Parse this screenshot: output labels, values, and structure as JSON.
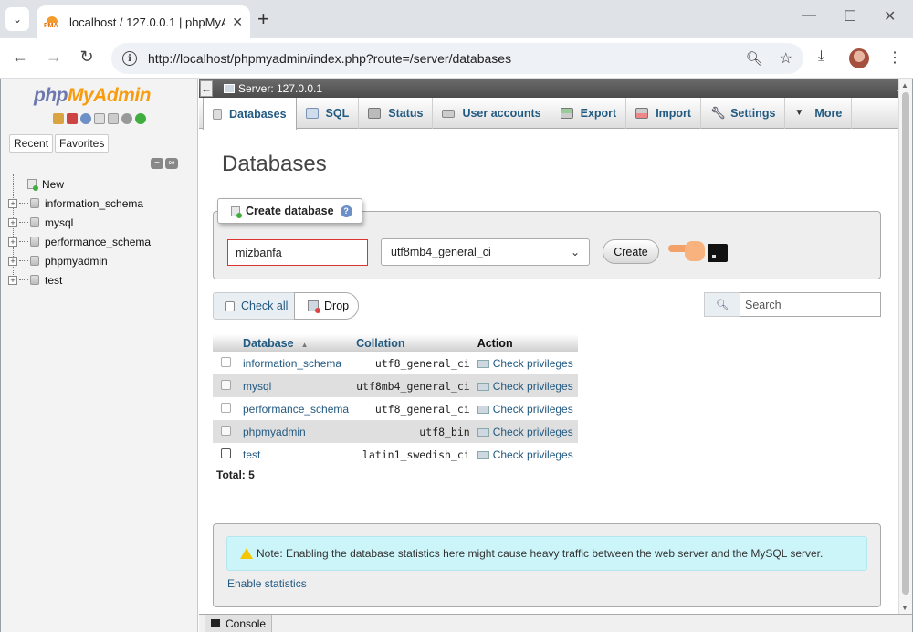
{
  "browser": {
    "tab_title": "localhost / 127.0.0.1 | phpMyAdmin",
    "url": "http://localhost/phpmyadmin/index.php?route=/server/databases"
  },
  "sidebar": {
    "logo_php": "php",
    "logo_myadmin": "MyAdmin",
    "recent_label": "Recent",
    "favorites_label": "Favorites",
    "tree": [
      {
        "label": "New",
        "type": "new"
      },
      {
        "label": "information_schema",
        "type": "db"
      },
      {
        "label": "mysql",
        "type": "db"
      },
      {
        "label": "performance_schema",
        "type": "db"
      },
      {
        "label": "phpmyadmin",
        "type": "db"
      },
      {
        "label": "test",
        "type": "db"
      }
    ]
  },
  "server": {
    "label": "Server: 127.0.0.1"
  },
  "tabs": [
    {
      "label": "Databases",
      "icon": "database-icon",
      "active": true
    },
    {
      "label": "SQL",
      "icon": "sql-icon"
    },
    {
      "label": "Status",
      "icon": "status-icon"
    },
    {
      "label": "User accounts",
      "icon": "users-icon"
    },
    {
      "label": "Export",
      "icon": "export-icon"
    },
    {
      "label": "Import",
      "icon": "import-icon"
    },
    {
      "label": "Settings",
      "icon": "wrench-icon"
    },
    {
      "label": "More",
      "icon": "caret-down-icon"
    }
  ],
  "page": {
    "title": "Databases",
    "create": {
      "legend": "Create database",
      "db_name_value": "mizbanfa",
      "collation_value": "utf8mb4_general_ci",
      "create_label": "Create"
    },
    "check_all_label": "Check all",
    "drop_label": "Drop",
    "search_placeholder": "Search",
    "table": {
      "headers": {
        "database": "Database",
        "collation": "Collation",
        "action": "Action"
      },
      "rows": [
        {
          "name": "information_schema",
          "collation": "utf8_general_ci",
          "action": "Check privileges"
        },
        {
          "name": "mysql",
          "collation": "utf8mb4_general_ci",
          "action": "Check privileges"
        },
        {
          "name": "performance_schema",
          "collation": "utf8_general_ci",
          "action": "Check privileges"
        },
        {
          "name": "phpmyadmin",
          "collation": "utf8_bin",
          "action": "Check privileges"
        },
        {
          "name": "test",
          "collation": "latin1_swedish_ci",
          "action": "Check privileges"
        }
      ]
    },
    "total": "Total: 5",
    "note": "Note: Enabling the database statistics here might cause heavy traffic between the web server and the MySQL server.",
    "enable_stats_label": "Enable statistics"
  },
  "console_label": "Console",
  "colors": {
    "link_blue": "#235a81",
    "logo_php": "#6c78af",
    "logo_myadmin": "#f89c0e",
    "note_bg": "#ccf5fa",
    "input_error_border": "#dd3333"
  }
}
